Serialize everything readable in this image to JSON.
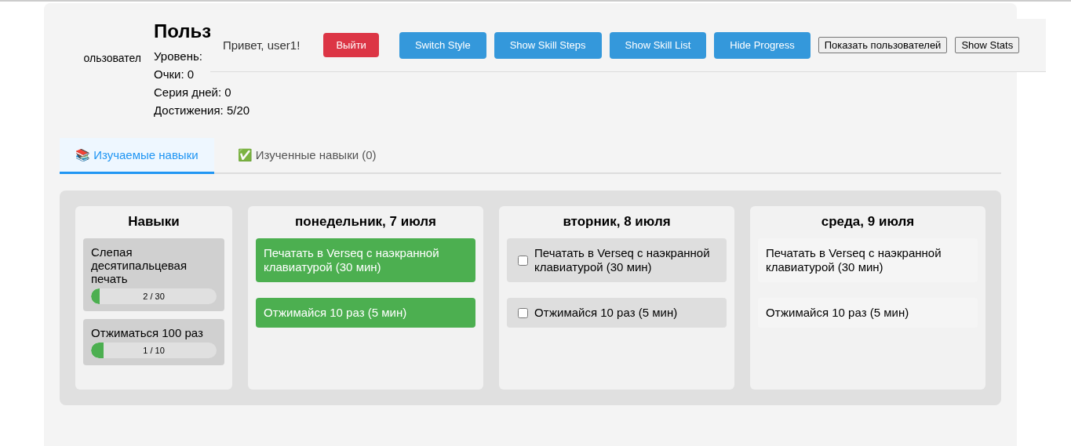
{
  "profile": {
    "avatar_alt": "ользовател",
    "name": "Польз",
    "stats": [
      "Уровень:",
      "Очки: 0",
      "Серия дней: 0",
      "Достижения: 5/20"
    ]
  },
  "header": {
    "greeting": "Привет, user1!",
    "logout": "Выйти",
    "buttons": [
      {
        "label": "Switch Style",
        "kind": "primary"
      },
      {
        "label": "Show Skill Steps",
        "kind": "primary"
      },
      {
        "label": "Show Skill List",
        "kind": "primary"
      },
      {
        "label": "Hide Progress",
        "kind": "primary"
      },
      {
        "label": "Показать пользователей",
        "kind": "plain"
      },
      {
        "label": "Show Stats",
        "kind": "plain"
      }
    ]
  },
  "tabs": [
    {
      "icon": "📚",
      "label": "Изучаемые навыки",
      "selected": true
    },
    {
      "icon": "✅",
      "label": "Изученные навыки (0)",
      "selected": false
    }
  ],
  "skills": {
    "title": "Навыки",
    "items": [
      {
        "name": "Слепая десятипальцевая печать",
        "progress": "2 / 30",
        "level": 0.067
      },
      {
        "name": "Отжиматься 100 раз",
        "progress": "1 / 10",
        "level": 0.1
      }
    ]
  },
  "days": [
    {
      "title": "понедельник, 7 июля",
      "tasks": [
        {
          "text": "Печатать в Verseq с наэкранной клавиатурой (30 мин)",
          "kind": "done"
        },
        {
          "text": "Отжимайся 10 раз (5 мин)",
          "kind": "done"
        }
      ]
    },
    {
      "title": "вторник, 8 июля",
      "tasks": [
        {
          "text": "Печатать в Verseq с наэкранной клавиатурой (30 мин)",
          "kind": "todo",
          "checked": false
        },
        {
          "text": "Отжимайся 10 раз (5 мин)",
          "kind": "todo",
          "checked": false
        }
      ]
    },
    {
      "title": "среда, 9 июля",
      "tasks": [
        {
          "text": "Печатать в Verseq с наэкранной клавиатурой (30 мин)",
          "kind": "future"
        },
        {
          "text": "Отжимайся 10 раз (5 мин)",
          "kind": "future"
        }
      ]
    }
  ]
}
